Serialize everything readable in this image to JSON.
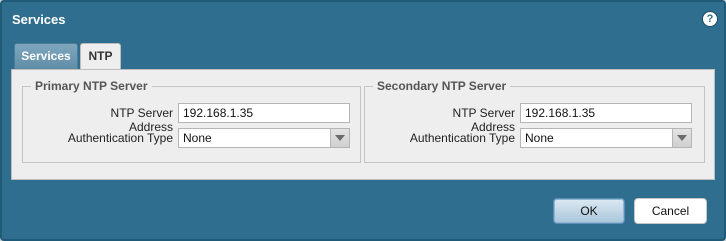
{
  "dialog": {
    "title": "Services",
    "help_icon": "help-icon",
    "help_symbol": "?"
  },
  "tabs": [
    {
      "label": "Services",
      "active": false
    },
    {
      "label": "NTP",
      "active": true
    }
  ],
  "primary": {
    "legend": "Primary NTP Server",
    "address_label": "NTP Server Address",
    "address_value": "192.168.1.35",
    "auth_label": "Authentication Type",
    "auth_value": "None"
  },
  "secondary": {
    "legend": "Secondary NTP Server",
    "address_label": "NTP Server Address",
    "address_value": "192.168.1.35",
    "auth_label": "Authentication Type",
    "auth_value": "None"
  },
  "buttons": {
    "ok": "OK",
    "cancel": "Cancel"
  },
  "colors": {
    "dialog_bg": "#2f6e8e",
    "panel_bg": "#eeeeee"
  }
}
